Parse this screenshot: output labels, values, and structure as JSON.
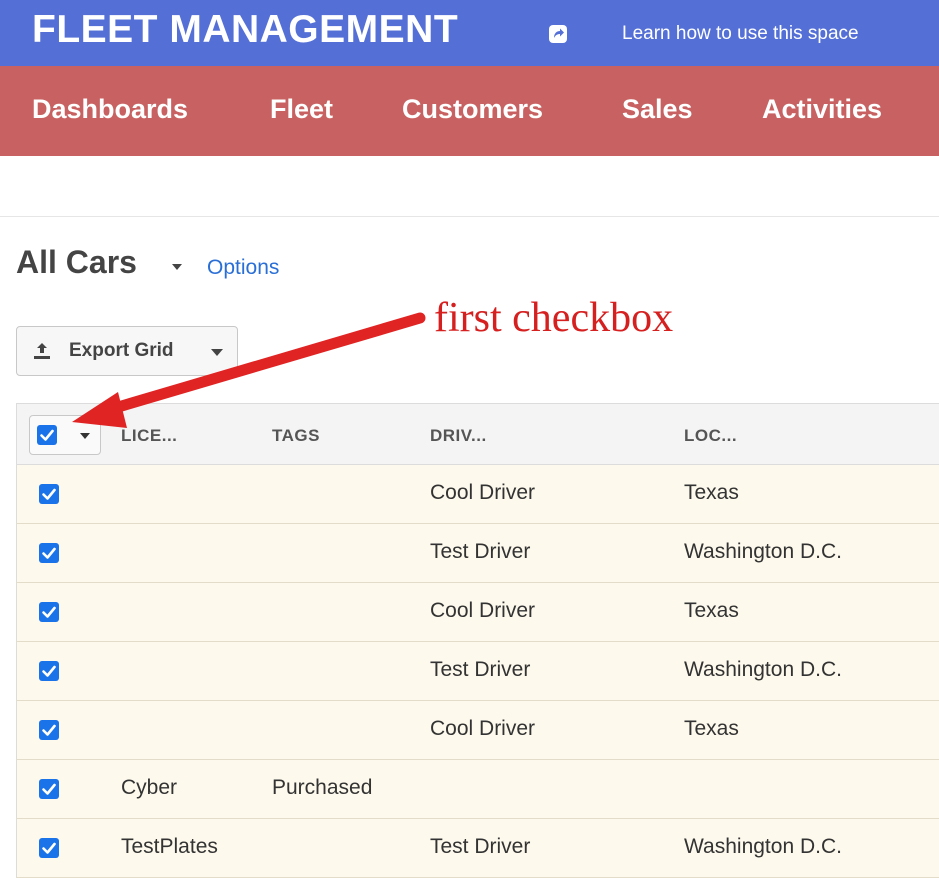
{
  "header": {
    "brand": "FLEET MANAGEMENT",
    "share_icon": "share-icon",
    "learn_link": "Learn how to use this space"
  },
  "nav": {
    "items": [
      {
        "label": "Dashboards"
      },
      {
        "label": "Fleet"
      },
      {
        "label": "Customers"
      },
      {
        "label": "Sales"
      },
      {
        "label": "Activities"
      }
    ]
  },
  "view": {
    "title": "All Cars",
    "options_label": "Options"
  },
  "toolbar": {
    "export_label": "Export Grid",
    "export_icon": "upload-icon"
  },
  "annotation": {
    "text": "first checkbox",
    "color": "#d62020"
  },
  "grid": {
    "columns": [
      "LICE...",
      "TAGS",
      "DRIV...",
      "LOC..."
    ],
    "select_all_checked": true,
    "rows": [
      {
        "checked": true,
        "license": "",
        "tags": "",
        "driver": "Cool Driver",
        "location": "Texas"
      },
      {
        "checked": true,
        "license": "",
        "tags": "",
        "driver": "Test Driver",
        "location": "Washington D.C."
      },
      {
        "checked": true,
        "license": "",
        "tags": "",
        "driver": "Cool Driver",
        "location": "Texas"
      },
      {
        "checked": true,
        "license": "",
        "tags": "",
        "driver": "Test Driver",
        "location": "Washington D.C."
      },
      {
        "checked": true,
        "license": "",
        "tags": "",
        "driver": "Cool Driver",
        "location": "Texas"
      },
      {
        "checked": true,
        "license": "Cyber",
        "tags": "Purchased",
        "driver": "",
        "location": ""
      },
      {
        "checked": true,
        "license": "TestPlates",
        "tags": "",
        "driver": "Test Driver",
        "location": "Washington D.C."
      }
    ]
  },
  "colors": {
    "topbar": "#5470d6",
    "navbar": "#c86262",
    "checkbox": "#1a73e8",
    "row_bg": "#fdf9ec",
    "link": "#2a6fd6"
  }
}
